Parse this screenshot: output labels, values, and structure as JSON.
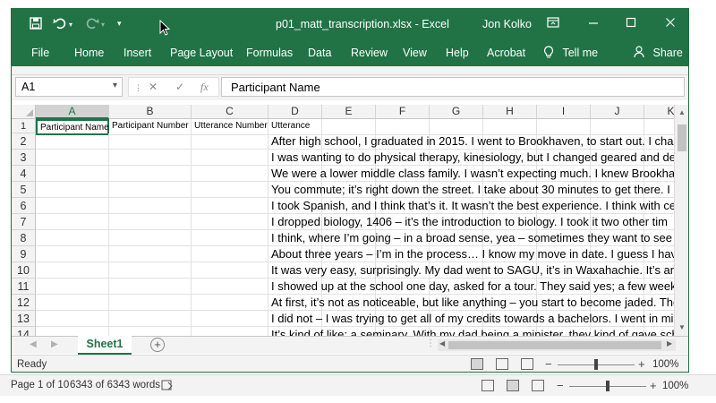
{
  "titlebar": {
    "filename": "p01_matt_transcription.xlsx",
    "separator": "-",
    "app": "Excel",
    "user": "Jon Kolko",
    "icons": [
      "save-icon",
      "undo-icon",
      "redo-icon",
      "customize-qat-icon",
      "ribbon-display-icon",
      "minimize-icon",
      "maximize-icon",
      "close-icon"
    ]
  },
  "ribbon": {
    "tabs": [
      "File",
      "Home",
      "Insert",
      "Page Layout",
      "Formulas",
      "Data",
      "Review",
      "View",
      "Help",
      "Acrobat"
    ],
    "tell_me": "Tell me",
    "share": "Share"
  },
  "formula_bar": {
    "name_box": "A1",
    "fx": "fx",
    "value": "Participant Name"
  },
  "columns": [
    "A",
    "B",
    "C",
    "D",
    "E",
    "F",
    "G",
    "H",
    "I",
    "J",
    "K"
  ],
  "selected_column": "A",
  "header_row": [
    "Participant Name",
    "Participant Number",
    "Utterance Number",
    "Utterance"
  ],
  "rows": [
    {
      "n": "1"
    },
    {
      "n": "2",
      "d": "After high school, I graduated in 2015. I went to Brookhaven, to start out. I chan"
    },
    {
      "n": "3",
      "d": "I was wanting to do physical therapy, kinesiology, but I changed geared and dec"
    },
    {
      "n": "4",
      "d": "We were a lower middle class family. I wasn’t expecting much. I knew Brookha"
    },
    {
      "n": "5",
      "d": "You commute; it’s right down the street. I take about 30 minutes to get there. I"
    },
    {
      "n": "6",
      "d": "I took Spanish, and I think that’s it. It wasn’t the best experience. I think with ce"
    },
    {
      "n": "7",
      "d": "I dropped biology, 1406 – it’s the introduction to biology. I took it two other tim"
    },
    {
      "n": "8",
      "d": "I think, where I’m going – in a broad sense, yea – sometimes they want to see y"
    },
    {
      "n": "9",
      "d": "About three years – I’m in the process… I know my move in date. I guess I have"
    },
    {
      "n": "10",
      "d": "It was very easy, surprisingly. My dad went to SAGU, it’s in Waxahachie. It’s an"
    },
    {
      "n": "11",
      "d": "I showed up at the school one day, asked for a tour. They said yes; a few weeks"
    },
    {
      "n": "12",
      "d": "At first, it’s not as noticeable, but like anything – you start to become jaded. The"
    },
    {
      "n": "13",
      "d": "I did not – I was trying to get all of my credits towards a bachelors. I went in mi"
    },
    {
      "n": "14",
      "d": "It’s kind of like: a seminary. With my dad being a minister, they kind of gave sch"
    }
  ],
  "sheets": [
    "Sheet1"
  ],
  "status": {
    "ready": "Ready",
    "zoom": "100%",
    "minus": "−",
    "plus": "+",
    "zoom_level": 0.5
  },
  "word_status": {
    "page": "Page 1 of 10",
    "words": "6343 of 6343 words",
    "zoom": "100%",
    "minus": "−",
    "plus": "+",
    "zoom_level": 0.5
  }
}
